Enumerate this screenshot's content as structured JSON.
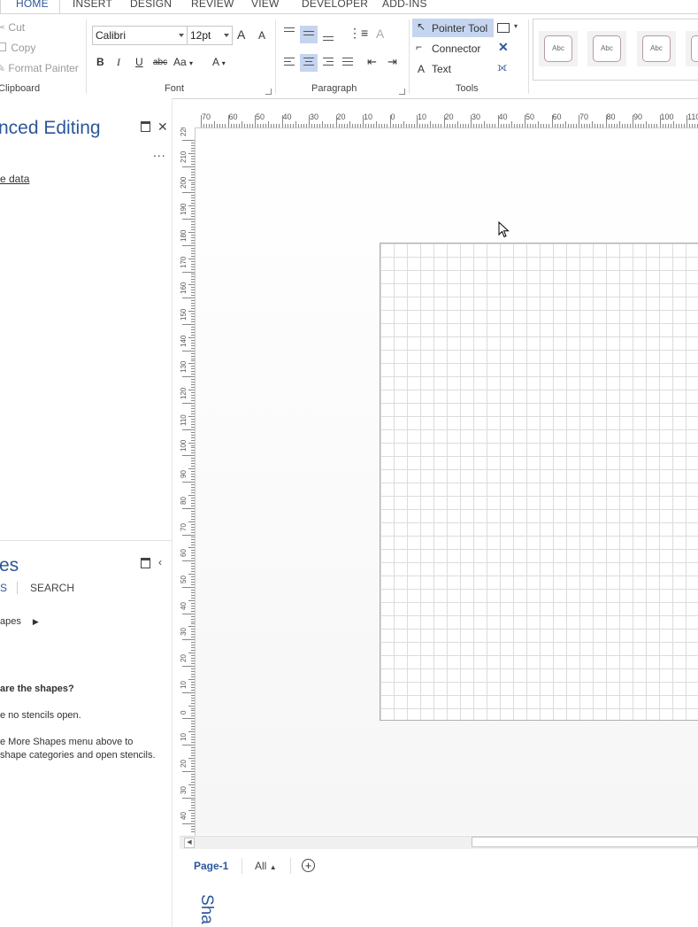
{
  "ribbon_tabs": [
    "HOME",
    "INSERT",
    "DESIGN",
    "REVIEW",
    "VIEW",
    "DEVELOPER",
    "ADD-INS"
  ],
  "active_tab": "HOME",
  "clipboard": {
    "cut": "Cut",
    "copy": "Copy",
    "format_painter": "Format Painter",
    "label": "Clipboard"
  },
  "font": {
    "family": "Calibri",
    "size": "12pt",
    "grow": "A",
    "shrink": "A",
    "bold": "B",
    "italic": "I",
    "underline": "U",
    "strike": "abc",
    "case": "Aa",
    "color": "A",
    "label": "Font"
  },
  "paragraph": {
    "label": "Paragraph"
  },
  "tools": {
    "pointer": "Pointer Tool",
    "connector": "Connector",
    "text": "Text",
    "label": "Tools"
  },
  "styles": [
    "Abc",
    "Abc",
    "Abc"
  ],
  "left_panel": {
    "advanced_title": "nced Editing",
    "more": "...",
    "data_link": "e data",
    "shapes_title": "es",
    "tab_stencils": "S",
    "tab_search": "SEARCH",
    "more_shapes": "apes",
    "help_heading": "are the shapes?",
    "help_line1": "e no stencils open.",
    "help_line2": "e More Shapes menu above to",
    "help_line3": "shape categories and open stencils."
  },
  "ruler_top_labels": [
    "70",
    "60",
    "50",
    "40",
    "30",
    "20",
    "10",
    "0",
    "10",
    "20",
    "30",
    "40",
    "50",
    "60",
    "70",
    "80",
    "90",
    "100",
    "110"
  ],
  "ruler_left_labels": [
    "220",
    "210",
    "200",
    "190",
    "180",
    "170",
    "160",
    "150",
    "140",
    "130",
    "120",
    "110",
    "100",
    "90",
    "80",
    "70",
    "60",
    "50",
    "40",
    "30",
    "20",
    "10",
    "0",
    "10",
    "20",
    "30",
    "40"
  ],
  "page_tabs": {
    "page": "Page-1",
    "all": "All"
  },
  "collapsed_shapes": "Sha",
  "colors": {
    "accent": "#2b579a",
    "selected": "#c5d5f0"
  }
}
